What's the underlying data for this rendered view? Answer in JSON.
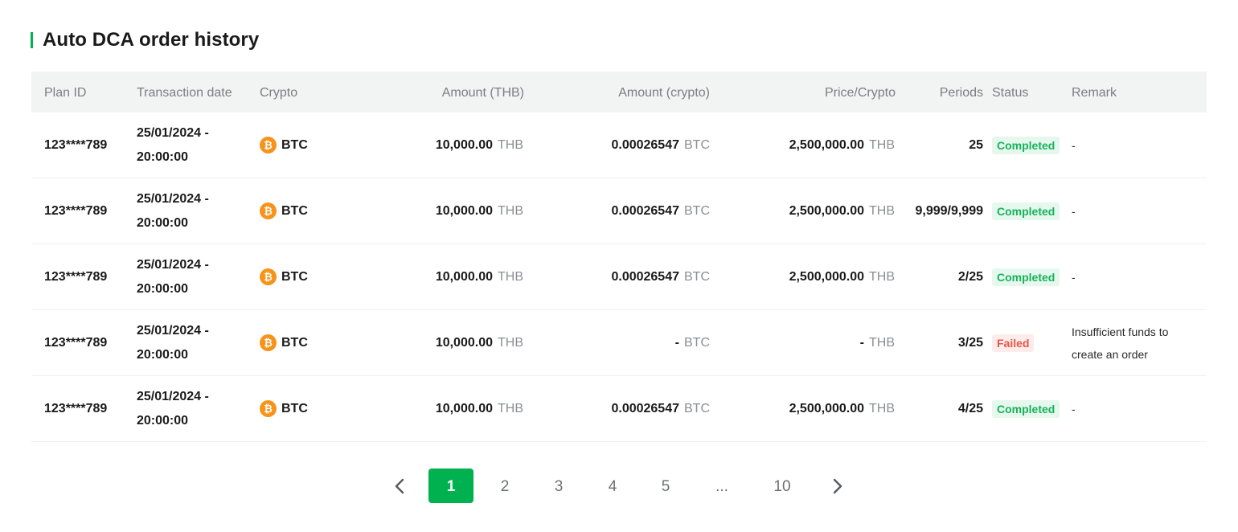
{
  "title": "Auto DCA order history",
  "columns": {
    "plan_id": "Plan ID",
    "transaction_date": "Transaction date",
    "crypto": "Crypto",
    "amount_thb": "Amount (THB)",
    "amount_crypto": "Amount (crypto)",
    "price_crypto": "Price/Crypto",
    "periods": "Periods",
    "status": "Status",
    "remark": "Remark"
  },
  "rows": [
    {
      "plan_id": "123****789",
      "date": "25/01/2024 -",
      "time": "20:00:00",
      "crypto": "BTC",
      "amount_thb": "10,000.00",
      "amount_thb_unit": "THB",
      "amount_crypto": "0.00026547",
      "amount_crypto_unit": "BTC",
      "price": "2,500,000.00",
      "price_unit": "THB",
      "periods": "25",
      "status": "Completed",
      "remark": "-"
    },
    {
      "plan_id": "123****789",
      "date": "25/01/2024 -",
      "time": "20:00:00",
      "crypto": "BTC",
      "amount_thb": "10,000.00",
      "amount_thb_unit": "THB",
      "amount_crypto": "0.00026547",
      "amount_crypto_unit": "BTC",
      "price": "2,500,000.00",
      "price_unit": "THB",
      "periods": "9,999/9,999",
      "status": "Completed",
      "remark": "-"
    },
    {
      "plan_id": "123****789",
      "date": "25/01/2024 -",
      "time": "20:00:00",
      "crypto": "BTC",
      "amount_thb": "10,000.00",
      "amount_thb_unit": "THB",
      "amount_crypto": "0.00026547",
      "amount_crypto_unit": "BTC",
      "price": "2,500,000.00",
      "price_unit": "THB",
      "periods": "2/25",
      "status": "Completed",
      "remark": "-"
    },
    {
      "plan_id": "123****789",
      "date": "25/01/2024 -",
      "time": "20:00:00",
      "crypto": "BTC",
      "amount_thb": "10,000.00",
      "amount_thb_unit": "THB",
      "amount_crypto": "-",
      "amount_crypto_unit": "BTC",
      "price": "-",
      "price_unit": "THB",
      "periods": "3/25",
      "status": "Failed",
      "remark": "Insufficient funds to create an order"
    },
    {
      "plan_id": "123****789",
      "date": "25/01/2024 -",
      "time": "20:00:00",
      "crypto": "BTC",
      "amount_thb": "10,000.00",
      "amount_thb_unit": "THB",
      "amount_crypto": "0.00026547",
      "amount_crypto_unit": "BTC",
      "price": "2,500,000.00",
      "price_unit": "THB",
      "periods": "4/25",
      "status": "Completed",
      "remark": "-"
    }
  ],
  "pagination": {
    "pages": [
      "1",
      "2",
      "3",
      "4",
      "5",
      "...",
      "10"
    ],
    "current": "1",
    "prev_icon": "chevron-left-icon",
    "next_icon": "chevron-right-icon"
  },
  "colors": {
    "accent": "#00b14f",
    "completed_text": "#15b35a",
    "completed_bg": "#e6f7ee",
    "failed_text": "#e6554a",
    "failed_bg": "#fdecea",
    "bitcoin": "#f7931a"
  },
  "crypto_icon": "bitcoin-icon"
}
